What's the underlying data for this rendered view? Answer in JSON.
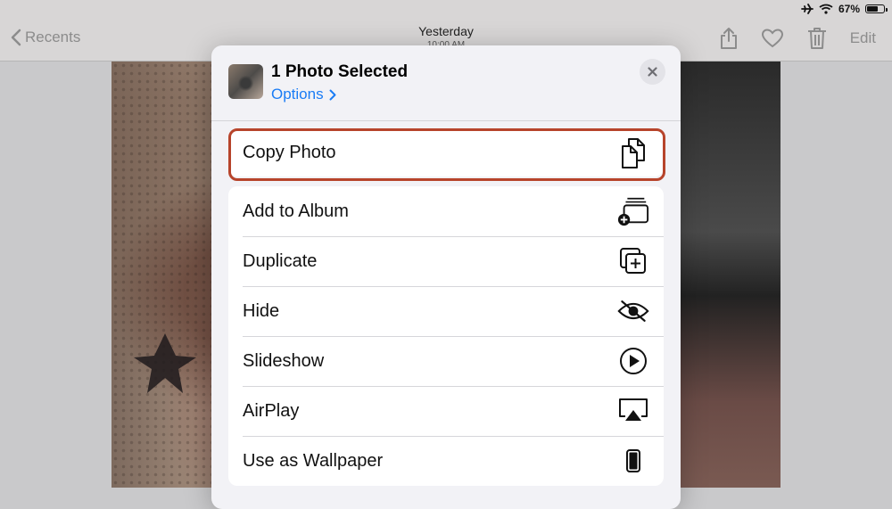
{
  "status": {
    "battery_percent": "67%",
    "battery_level": 0.67
  },
  "nav": {
    "back_label": "Recents",
    "title": "Yesterday",
    "subtitle": "10:00 AM",
    "edit_label": "Edit"
  },
  "sheet": {
    "title": "1 Photo Selected",
    "options_label": "Options"
  },
  "actions": {
    "copy_photo": "Copy Photo",
    "add_to_album": "Add to Album",
    "duplicate": "Duplicate",
    "hide": "Hide",
    "slideshow": "Slideshow",
    "airplay": "AirPlay",
    "use_as_wallpaper": "Use as Wallpaper"
  },
  "colors": {
    "accent": "#1a7cf5",
    "highlight_border": "#b7442b"
  }
}
